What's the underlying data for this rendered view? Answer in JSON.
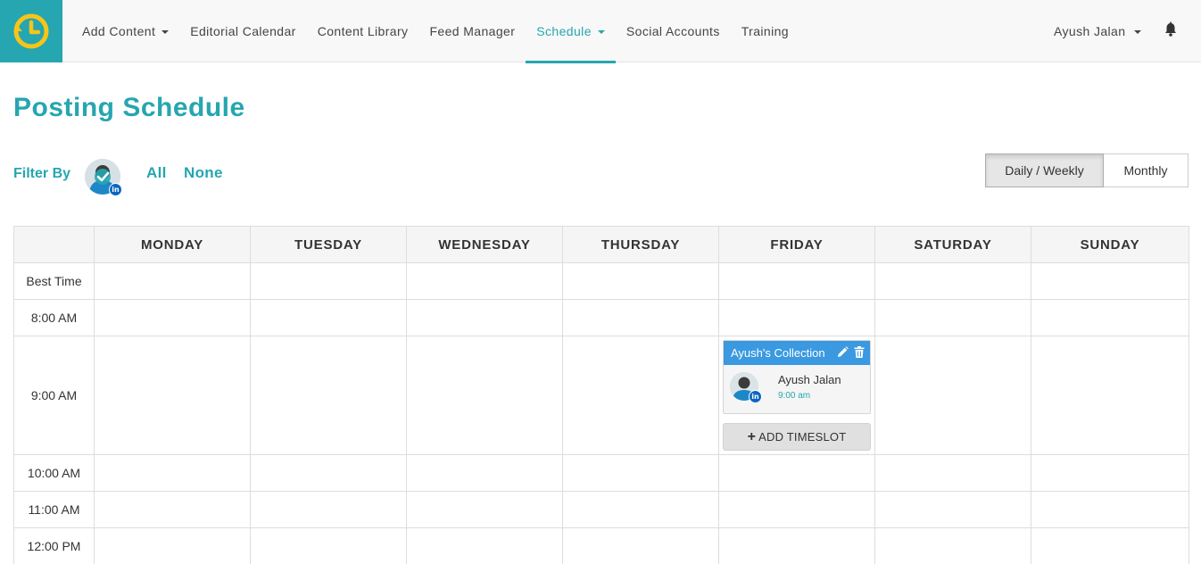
{
  "nav": {
    "items": [
      {
        "label": "Add Content",
        "dropdown": true,
        "active": false
      },
      {
        "label": "Editorial Calendar",
        "dropdown": false,
        "active": false
      },
      {
        "label": "Content Library",
        "dropdown": false,
        "active": false
      },
      {
        "label": "Feed Manager",
        "dropdown": false,
        "active": false
      },
      {
        "label": "Schedule",
        "dropdown": true,
        "active": true
      },
      {
        "label": "Social Accounts",
        "dropdown": false,
        "active": false
      },
      {
        "label": "Training",
        "dropdown": false,
        "active": false
      }
    ],
    "user_label": "Ayush Jalan",
    "notification_icon": "bell-icon"
  },
  "colors": {
    "brand": "#26a6b0",
    "logo_accent": "#f7c518",
    "card_header": "#3a99e0",
    "linkedin": "#0a66c2"
  },
  "page": {
    "title": "Posting Schedule"
  },
  "filter": {
    "label": "Filter By",
    "all_label": "All",
    "none_label": "None"
  },
  "view_toggle": {
    "options": [
      "Daily / Weekly",
      "Monthly"
    ],
    "selected": "Daily / Weekly"
  },
  "schedule": {
    "days": [
      "MONDAY",
      "TUESDAY",
      "WEDNESDAY",
      "THURSDAY",
      "FRIDAY",
      "SATURDAY",
      "SUNDAY"
    ],
    "rows": [
      "Best Time",
      "8:00 AM",
      "9:00 AM",
      "10:00 AM",
      "11:00 AM",
      "12:00 PM"
    ],
    "post": {
      "day": "FRIDAY",
      "row": "9:00 AM",
      "collection": "Ayush's Collection",
      "account_name": "Ayush Jalan",
      "time": "9:00 am",
      "network_badge": "in"
    },
    "add_timeslot_label": "ADD TIMESLOT"
  }
}
